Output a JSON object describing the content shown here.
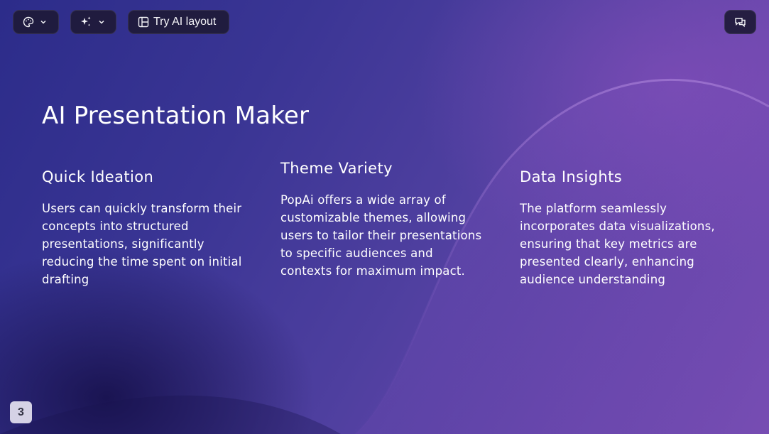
{
  "toolbar": {
    "theme_icon": "palette-icon",
    "ai_icon": "sparkles-icon",
    "layout_icon": "layout-icon",
    "layout_label": "Try AI layout",
    "chat_icon": "chat-icon"
  },
  "slide": {
    "title": "AI Presentation Maker",
    "columns": [
      {
        "heading": "Quick Ideation",
        "body": "Users can quickly transform their concepts into structured presentations, significantly reducing the time spent on initial drafting"
      },
      {
        "heading": "Theme Variety",
        "body": "PopAi offers a wide array of customizable themes, allowing users to tailor their presentations to specific audiences and contexts for maximum impact."
      },
      {
        "heading": "Data Insights",
        "body": "The platform seamlessly incorporates data visualizations, ensuring that key metrics are presented clearly, enhancing audience understanding"
      }
    ],
    "page_number": "3"
  },
  "colors": {
    "background_start": "#2c2c8a",
    "background_end": "#7a4fb4",
    "text": "#ffffff",
    "button_bg": "#1e1a38"
  }
}
